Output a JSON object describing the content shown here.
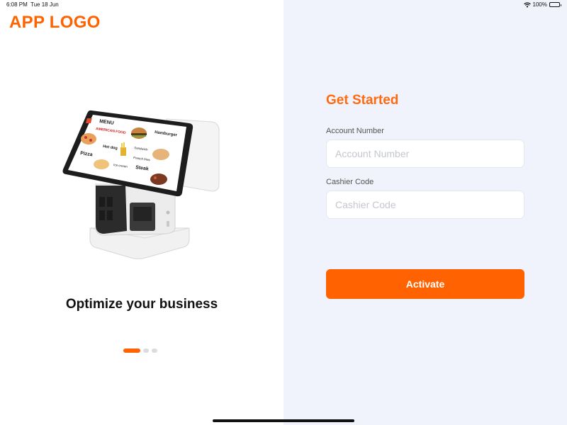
{
  "status_bar": {
    "time": "6:08 PM",
    "date": "Tue 18 Jun",
    "battery": "100%",
    "icons": [
      "wifi-icon",
      "battery-icon"
    ]
  },
  "logo": {
    "text": "APP LOGO",
    "color": "#ff6200"
  },
  "illustration": {
    "icon": "pos-kiosk-illustration",
    "menu_labels": {
      "menu": "MENU",
      "subtitle": "AMERICAN FOOD",
      "hamburger": "Hamburger",
      "pizza": "Pizza",
      "hotdog": "Hot dog",
      "sandwich": "Sandwich",
      "fries": "French fries",
      "steak": "Steak",
      "icecream": "Ice cream"
    }
  },
  "onboarding": {
    "tagline": "Optimize your business",
    "pager": {
      "count": 3,
      "active_index": 0
    }
  },
  "form": {
    "title": "Get Started",
    "account_number": {
      "label": "Account Number",
      "placeholder": "Account Number",
      "value": ""
    },
    "cashier_code": {
      "label": "Cashier Code",
      "placeholder": "Cashier Code",
      "value": ""
    },
    "submit_label": "Activate"
  },
  "colors": {
    "accent": "#ff6200",
    "form_background": "#f0f3fb",
    "left_background": "#ffffff"
  }
}
